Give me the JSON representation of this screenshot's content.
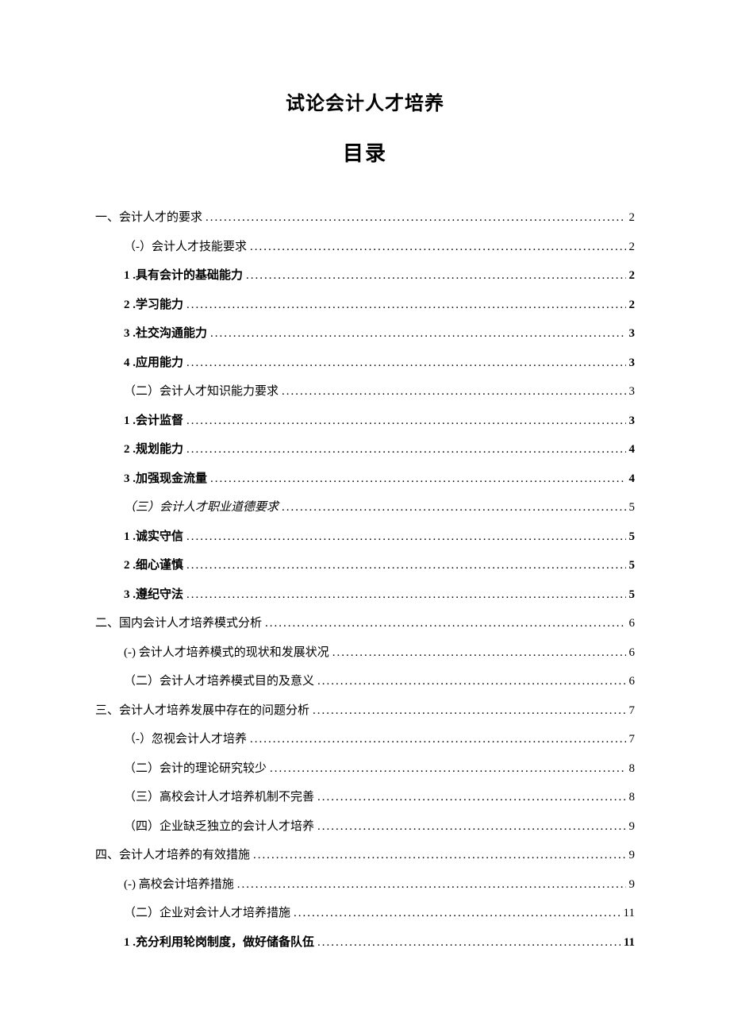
{
  "title": "试论会计人才培养",
  "subtitle": "目录",
  "toc": [
    {
      "level": 1,
      "label": "一、会计人才的要求",
      "page": "2",
      "bold": false
    },
    {
      "level": 2,
      "label": "（-）会计人才技能要求",
      "page": "2",
      "bold": false
    },
    {
      "level": 2,
      "label": "1 .具有会计的基础能力",
      "page": "2",
      "bold": true
    },
    {
      "level": 2,
      "label": "2   .学习能力",
      "page": "2",
      "bold": true
    },
    {
      "level": 2,
      "label": "3  .社交沟通能力",
      "page": "3",
      "bold": true
    },
    {
      "level": 2,
      "label": "4  .应用能力",
      "page": "3",
      "bold": true
    },
    {
      "level": 2,
      "label": "（二）会计人才知识能力要求",
      "page": "3",
      "bold": false
    },
    {
      "level": 2,
      "label": "1 .会计监督",
      "page": "3",
      "bold": true
    },
    {
      "level": 2,
      "label": "2  .规划能力",
      "page": "4",
      "bold": true
    },
    {
      "level": 2,
      "label": "3  .加强现金流量",
      "page": "4",
      "bold": true
    },
    {
      "level": 2,
      "label": "（三）会计人才职业道德要求",
      "page": "5",
      "bold": false,
      "italic": true
    },
    {
      "level": 2,
      "label": "1 .诚实守信",
      "page": "5",
      "bold": true
    },
    {
      "level": 2,
      "label": "2  .细心谨慎",
      "page": "5",
      "bold": true
    },
    {
      "level": 2,
      "label": "3  .遵纪守法",
      "page": "5",
      "bold": true
    },
    {
      "level": 1,
      "label": "二、国内会计人才培养模式分析",
      "page": "6",
      "bold": false
    },
    {
      "level": 2,
      "label": "(-) 会计人才培养模式的现状和发展状况",
      "page": "6",
      "bold": false
    },
    {
      "level": 2,
      "label": "（二）会计人才培养模式目的及意义",
      "page": "6",
      "bold": false
    },
    {
      "level": 1,
      "label": "三、会计人才培养发展中存在的问题分析",
      "page": "7",
      "bold": false
    },
    {
      "level": 2,
      "label": "（-）忽视会计人才培养",
      "page": "7",
      "bold": false
    },
    {
      "level": 2,
      "label": "（二）会计的理论研究较少",
      "page": "8",
      "bold": false
    },
    {
      "level": 2,
      "label": "（三）高校会计人才培养机制不完善",
      "page": "8",
      "bold": false
    },
    {
      "level": 2,
      "label": "（四）企业缺乏独立的会计人才培养",
      "page": "9",
      "bold": false
    },
    {
      "level": 1,
      "label": "四、会计人才培养的有效措施",
      "page": "9",
      "bold": false
    },
    {
      "level": 2,
      "label": "(-) 高校会计培养措施",
      "page": "9",
      "bold": false
    },
    {
      "level": 2,
      "label": "（二）企业对会计人才培养措施",
      "page": "11",
      "bold": false
    },
    {
      "level": 2,
      "label": "1 .充分利用轮岗制度，做好储备队伍",
      "page": "11",
      "bold": true
    }
  ]
}
